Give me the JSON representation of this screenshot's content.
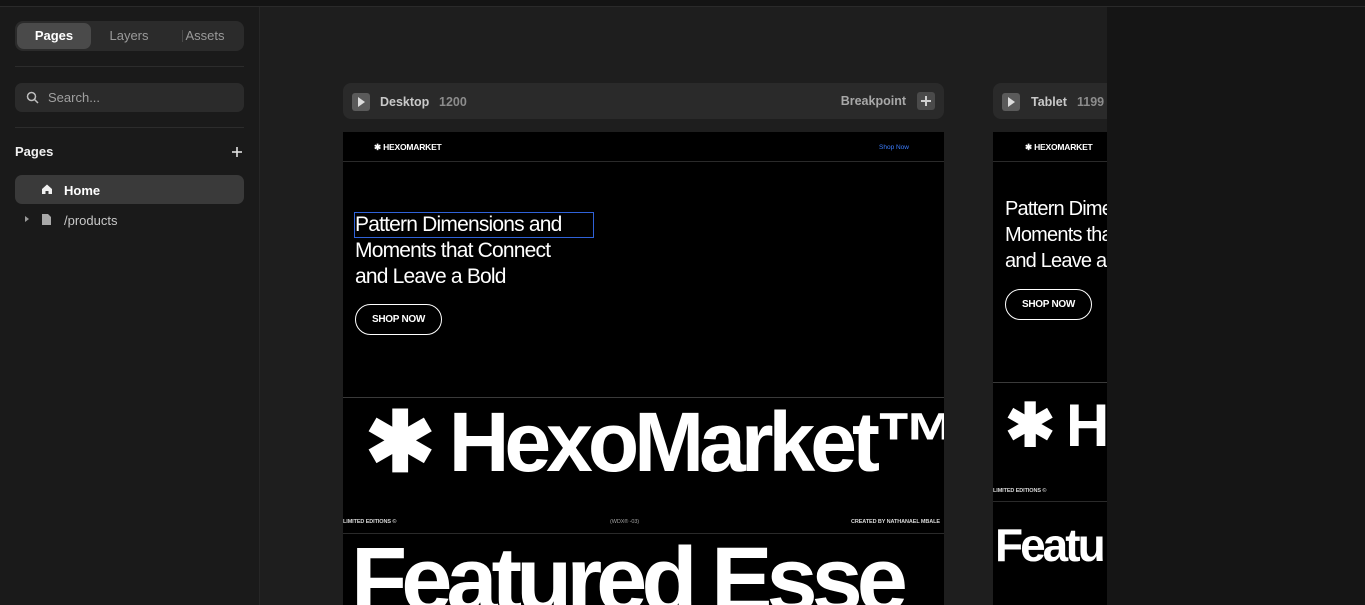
{
  "sidebar": {
    "tabs": [
      {
        "label": "Pages"
      },
      {
        "label": "Layers"
      },
      {
        "label": "Assets"
      }
    ],
    "search": {
      "placeholder": "Search..."
    },
    "pages_heading": "Pages",
    "pages": [
      {
        "label": "Home",
        "icon": "home-icon",
        "selected": true
      },
      {
        "label": "/products",
        "icon": "page-icon",
        "selected": false
      }
    ]
  },
  "breakpoints": [
    {
      "name": "Desktop",
      "width": "1200",
      "action_label": "Breakpoint"
    },
    {
      "name": "Tablet",
      "width": "1199"
    }
  ],
  "site": {
    "logo": "✱ HEXOMARKET",
    "nav_link": "Shop Now",
    "hero_lines": [
      "Pattern Dimensions and",
      "Moments that Connect",
      "and Leave a Bold"
    ],
    "hero_button": "SHOP NOW",
    "brand": "✱ HexoMarket™",
    "brand_tablet": "✱ H",
    "meta_left": "LIMITED EDITIONS ©",
    "meta_center": "(WDX® -03)",
    "meta_right": "CREATED BY NATHANAEL MBALE",
    "featured": "Featured Esse",
    "featured_tablet": "Featu"
  },
  "colors": {
    "selection": "#2f62d9",
    "link": "#3b7dff"
  }
}
